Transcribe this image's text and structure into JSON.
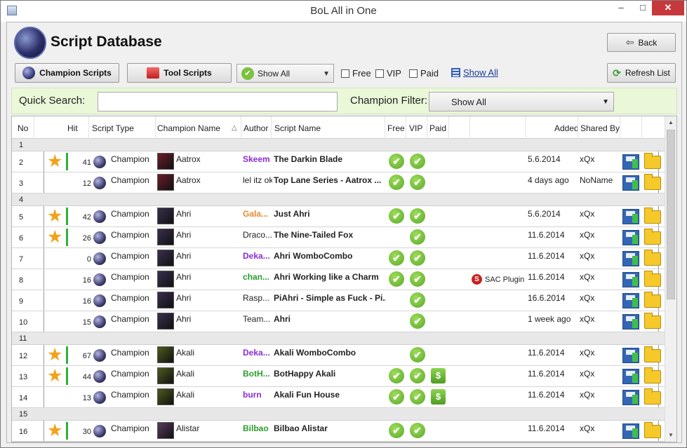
{
  "window": {
    "title": "BoL All in One",
    "minimize": "–",
    "maximize": "□",
    "close": "✕"
  },
  "header": {
    "title": "Script Database",
    "back_label": "Back"
  },
  "toolbar": {
    "champion_scripts_label": "Champion Scripts",
    "tool_scripts_label": "Tool Scripts",
    "show_combo_value": "Show All",
    "free_label": "Free",
    "vip_label": "VIP",
    "paid_label": "Paid",
    "show_all_link": "Show All",
    "refresh_label": "Refresh List"
  },
  "filter": {
    "quick_search_label": "Quick Search:",
    "quick_search_value": "",
    "champion_filter_label": "Champion Filter:",
    "champion_filter_value": "Show All"
  },
  "columns": {
    "no": "No",
    "hit": "Hit",
    "script_type": "Script Type",
    "champion_name": "Champion Name",
    "sort_indicator": "△",
    "author": "Author",
    "script_name": "Script Name",
    "free": "Free",
    "vip": "VIP",
    "paid": "Paid",
    "added": "Added",
    "shared_by": "Shared By"
  },
  "rows": [
    {
      "no": "1",
      "group": true
    },
    {
      "no": "2",
      "starred": true,
      "hit": "41",
      "type": "Champion",
      "champion": "Aatrox",
      "champ_color": "#6a1d2a",
      "author": "Skeem",
      "author_style": "purple",
      "script": "The Darkin Blade",
      "free": true,
      "vip": true,
      "paid": false,
      "added": "5.6.2014",
      "shared": "xQx"
    },
    {
      "no": "3",
      "starred": false,
      "hit": "12",
      "type": "Champion",
      "champion": "Aatrox",
      "champ_color": "#6a1d2a",
      "author": "lel itz ok",
      "author_style": "",
      "script": "Top Lane Series - Aatrox ...",
      "free": true,
      "vip": true,
      "paid": false,
      "added": "4 days ago",
      "shared": "NoName"
    },
    {
      "no": "4",
      "group": true
    },
    {
      "no": "5",
      "starred": true,
      "hit": "42",
      "type": "Champion",
      "champion": "Ahri",
      "champ_color": "#3a2f4e",
      "author": "Gala...",
      "author_style": "orange",
      "script": "Just Ahri",
      "free": true,
      "vip": true,
      "paid": false,
      "added": "5.6.2014",
      "shared": "xQx"
    },
    {
      "no": "6",
      "starred": true,
      "hit": "26",
      "type": "Champion",
      "champion": "Ahri",
      "champ_color": "#3a2f4e",
      "author": "Draco...",
      "author_style": "",
      "script": "The Nine-Tailed Fox",
      "free": false,
      "vip": true,
      "paid": false,
      "added": "11.6.2014",
      "shared": "xQx"
    },
    {
      "no": "7",
      "starred": false,
      "hit": "0",
      "type": "Champion",
      "champion": "Ahri",
      "champ_color": "#3a2f4e",
      "author": "Deka...",
      "author_style": "purple",
      "script": "Ahri WomboCombo",
      "free": true,
      "vip": true,
      "paid": false,
      "added": "11.6.2014",
      "shared": "xQx"
    },
    {
      "no": "8",
      "starred": false,
      "hit": "16",
      "type": "Champion",
      "champion": "Ahri",
      "champ_color": "#3a2f4e",
      "author": "chan...",
      "author_style": "green",
      "script": "Ahri Working like a Charm",
      "free": true,
      "vip": true,
      "paid": false,
      "sac": "SAC Plugin",
      "added": "11.6.2014",
      "shared": "xQx"
    },
    {
      "no": "9",
      "starred": false,
      "hit": "16",
      "type": "Champion",
      "champion": "Ahri",
      "champ_color": "#3a2f4e",
      "author": "Rasp...",
      "author_style": "",
      "script": "PiAhri - Simple as Fuck - Pi...",
      "free": false,
      "vip": true,
      "paid": false,
      "added": "16.6.2014",
      "shared": "xQx"
    },
    {
      "no": "10",
      "starred": false,
      "hit": "15",
      "type": "Champion",
      "champion": "Ahri",
      "champ_color": "#3a2f4e",
      "author": "Team...",
      "author_style": "",
      "script": "Ahri",
      "free": false,
      "vip": true,
      "paid": false,
      "added": "1 week ago",
      "shared": "xQx"
    },
    {
      "no": "11",
      "group": true
    },
    {
      "no": "12",
      "starred": true,
      "hit": "67",
      "type": "Champion",
      "champion": "Akali",
      "champ_color": "#4d5a1f",
      "author": "Deka...",
      "author_style": "purple",
      "script": "Akali WomboCombo",
      "free": false,
      "vip": true,
      "paid": false,
      "added": "11.6.2014",
      "shared": "xQx"
    },
    {
      "no": "13",
      "starred": true,
      "hit": "44",
      "type": "Champion",
      "champion": "Akali",
      "champ_color": "#4d5a1f",
      "author": "BotH...",
      "author_style": "green",
      "script": "BotHappy Akali",
      "free": true,
      "vip": true,
      "paid": true,
      "added": "11.6.2014",
      "shared": "xQx"
    },
    {
      "no": "14",
      "starred": false,
      "hit": "13",
      "type": "Champion",
      "champion": "Akali",
      "champ_color": "#4d5a1f",
      "author": "burn",
      "author_style": "purple",
      "script": "Akali Fun House",
      "free": true,
      "vip": true,
      "paid": true,
      "added": "11.6.2014",
      "shared": "xQx"
    },
    {
      "no": "15",
      "group": true
    },
    {
      "no": "16",
      "starred": true,
      "hit": "30",
      "type": "Champion",
      "champion": "Alistar",
      "champ_color": "#5a3a5e",
      "author": "Bilbao",
      "author_style": "green",
      "script": "Bilbao Alistar",
      "free": true,
      "vip": true,
      "paid": false,
      "added": "11.6.2014",
      "shared": "xQx"
    }
  ],
  "icons": {
    "star": "★",
    "check": "✔",
    "dollar": "$",
    "sac_letter": "S",
    "combo_arrow": "▼",
    "back_arrow": "⇦",
    "refresh": "⟳",
    "scroll_up": "▲",
    "scroll_down": "▼"
  }
}
